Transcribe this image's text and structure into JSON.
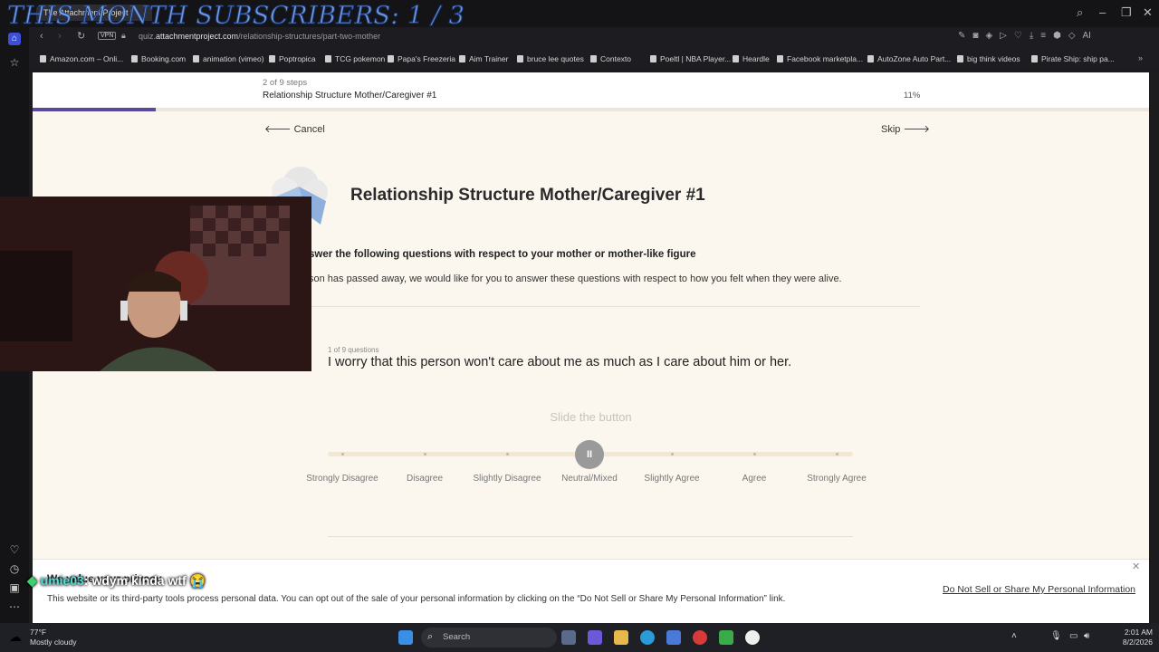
{
  "browser": {
    "tab_title": "The Attachment Project |",
    "url_prefix": "quiz.",
    "url_domain": "attachmentproject.com",
    "url_path": "/relationship-structures/part-two-mother",
    "vpn_label": "VPN",
    "bookmarks": [
      "Amazon.com – Onli...",
      "Booking.com",
      "animation (vimeo)",
      "Poptropica",
      "TCG pokemon",
      "Papa's Freezeria",
      "Aim Trainer",
      "bruce lee quotes",
      "Contexto",
      "Poeltl | NBA Player...",
      "Heardle",
      "Facebook marketpla...",
      "AutoZone Auto Part...",
      "big think videos",
      "Pirate Ship: ship pa..."
    ]
  },
  "stream_overlay": {
    "subscribers": "THIS MONTH SUBSCRIBERS: 1 / 3",
    "chat_user": "umie03",
    "chat_message": ": wdym kinda wtf 😭"
  },
  "quiz": {
    "steps": "2 of 9 steps",
    "step_title": "Relationship Structure Mother/Caregiver #1",
    "percent": "11%",
    "progress_fraction": 0.11,
    "cancel": "Cancel",
    "skip": "Skip",
    "title": "Relationship Structure Mother/Caregiver #1",
    "instruction": "swer the following questions with respect to your mother or mother-like figure",
    "note": "son has passed away, we would like for you to answer these questions with respect to how you felt when they were alive.",
    "question_count": "1 of 9 questions",
    "question": "I worry that this person won't care about me as much as I care about him or her.",
    "slide_hint": "Slide the button",
    "scale": [
      "Strongly Disagree",
      "Disagree",
      "Slightly Disagree",
      "Neutral/Mixed",
      "Slightly Agree",
      "Agree",
      "Strongly Agree"
    ],
    "selected_index": 3
  },
  "privacy": {
    "title": "We value your privacy",
    "text": "This website or its third-party tools process personal data. You can opt out of the sale of your personal information by clicking on the “Do Not Sell or Share My Personal Information” link.",
    "link": "Do Not Sell or Share My Personal Information"
  },
  "taskbar": {
    "temp": "77°F",
    "condition": "Mostly cloudy",
    "search": "Search",
    "time": "2:01 AM",
    "date": "8/2/2026"
  }
}
